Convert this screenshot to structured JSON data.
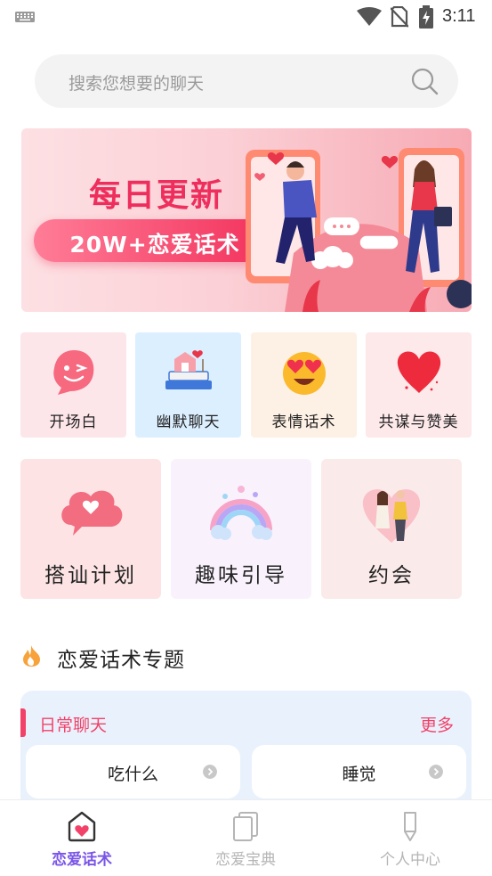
{
  "status_bar": {
    "time": "3:11"
  },
  "search": {
    "placeholder": "搜索您想要的聊天"
  },
  "banner": {
    "title": "每日更新",
    "pill": "20W+恋爱话术"
  },
  "categories_small": [
    {
      "label": "开场白",
      "bg": "#fde6ea",
      "icon": "wink-face-icon"
    },
    {
      "label": "幽默聊天",
      "bg": "#dcefff",
      "icon": "house-books-icon"
    },
    {
      "label": "表情话术",
      "bg": "#fdf0e4",
      "icon": "heart-eyes-emoji-icon"
    },
    {
      "label": "共谋与赞美",
      "bg": "#fde8ea",
      "icon": "red-heart-icon"
    }
  ],
  "categories_large": [
    {
      "label": "搭讪计划",
      "bg": "#fde3e4",
      "icon": "heart-cloud-icon"
    },
    {
      "label": "趣味引导",
      "bg": "#f9f1fc",
      "icon": "rainbow-icon"
    },
    {
      "label": "约会",
      "bg": "#fbeaea",
      "icon": "couple-icon"
    }
  ],
  "section": {
    "title": "恋爱话术专题"
  },
  "topic": {
    "name": "日常聊天",
    "more": "更多",
    "items": [
      "吃什么",
      "睡觉"
    ]
  },
  "nav": {
    "items": [
      {
        "label": "恋爱话术",
        "active": true
      },
      {
        "label": "恋爱宝典",
        "active": false
      },
      {
        "label": "个人中心",
        "active": false
      }
    ],
    "active_color": "#7a55e8",
    "inactive_color": "#b5b5b5"
  }
}
